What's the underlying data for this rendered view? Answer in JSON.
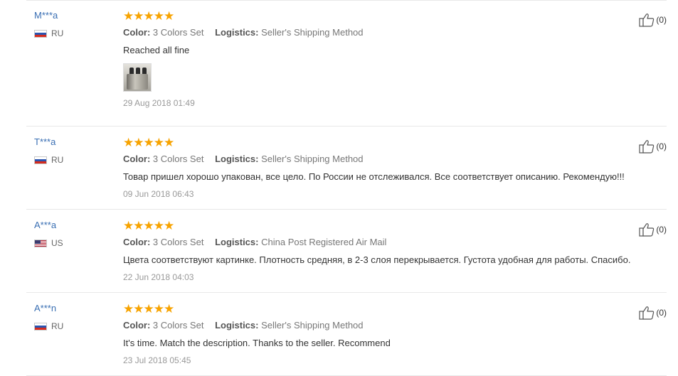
{
  "reviews": [
    {
      "user": "M***a",
      "country": "RU",
      "stars": "★★★★★",
      "color_label": "Color:",
      "color_value": "3 Colors Set",
      "logistics_label": "Logistics:",
      "logistics_value": "Seller's Shipping Method",
      "text": "Reached all fine",
      "date": "29 Aug 2018 01:49",
      "helpful": "(0)"
    },
    {
      "user": "T***a",
      "country": "RU",
      "stars": "★★★★★",
      "color_label": "Color:",
      "color_value": "3 Colors Set",
      "logistics_label": "Logistics:",
      "logistics_value": "Seller's Shipping Method",
      "text": "Товар пришел хорошо упакован, все цело. По России не отслеживался. Все соответствует описанию. Рекомендую!!!",
      "date": "09 Jun 2018 06:43",
      "helpful": "(0)"
    },
    {
      "user": "A***a",
      "country": "US",
      "stars": "★★★★★",
      "color_label": "Color:",
      "color_value": "3 Colors Set",
      "logistics_label": "Logistics:",
      "logistics_value": "China Post Registered Air Mail",
      "text": "Цвета соответствуют картинке. Плотность средняя, в 2-3 слоя перекрывается. Густота удобная для работы. Спасибо.",
      "date": "22 Jun 2018 04:03",
      "helpful": "(0)"
    },
    {
      "user": "A***n",
      "country": "RU",
      "stars": "★★★★★",
      "color_label": "Color:",
      "color_value": "3 Colors Set",
      "logistics_label": "Logistics:",
      "logistics_value": "Seller's Shipping Method",
      "text": "It's time. Match the description. Thanks to the seller. Recommend",
      "date": "23 Jul 2018 05:45",
      "helpful": "(0)"
    }
  ],
  "colors": {
    "user_link": "#3a6fb3",
    "stars": "#f7a300",
    "divider": "#e8e8e8"
  },
  "icons": {
    "helpful": "thumbs-up-icon",
    "flag_ru": "flag-ru-icon",
    "flag_us": "flag-us-icon"
  }
}
